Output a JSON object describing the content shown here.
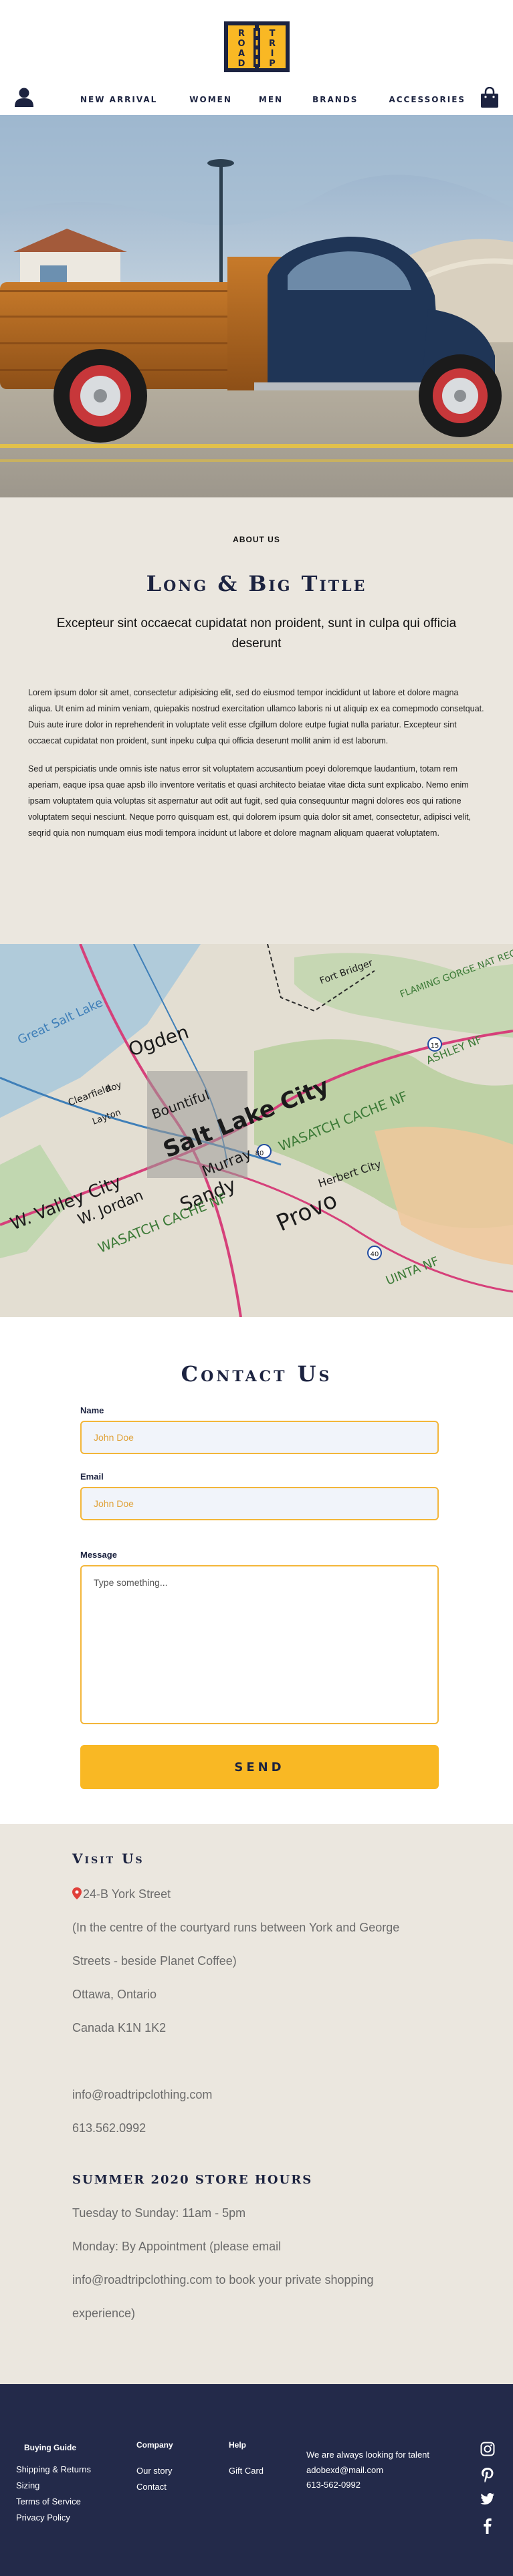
{
  "header": {
    "logo_text": [
      "R",
      "O",
      "A",
      "D",
      "T",
      "R",
      "I",
      "P"
    ],
    "nav": [
      "New arrival",
      "Women",
      "Men",
      "Brands",
      "Accessories"
    ]
  },
  "about": {
    "eyebrow": "ABOUT US",
    "title": "Long & Big Title",
    "subtitle": "Excepteur sint occaecat cupidatat non proident, sunt in culpa qui officia deserunt",
    "paragraphs": [
      "Lorem ipsum dolor sit amet, consectetur adipisicing elit, sed do eiusmod tempor incididunt ut labore et dolore magna aliqua. Ut enim ad minim veniam, quiepakis nostrud exercitation ullamco laboris ni ut aliquip ex ea comepmodo consetquat. Duis aute irure dolor in reprehenderit in voluptate velit esse cfgillum dolore eutpe fugiat nulla pariatur. Excepteur sint occaecat cupidatat non proident, sunt inpeku culpa qui officia deserunt mollit anim id est laborum.",
      "Sed ut perspiciatis unde omnis iste natus error sit voluptatem accusantium poeyi doloremque laudantium, totam rem aperiam, eaque ipsa quae apsb illo inventore veritatis et quasi architecto beiatae vitae dicta sunt explicabo. Nemo enim ipsam voluptatem quia voluptas sit aspernatur aut odit aut fugit, sed quia consequuntur magni dolores eos qui ratione voluptatem sequi nesciunt. Neque porro quisquam est, qui dolorem ipsum quia dolor sit amet, consectetur, adipisci velit, seqrid quia non numquam eius modi tempora incidunt ut labore et dolore magnam aliquam quaerat voluptatem."
    ]
  },
  "map_labels": {
    "ogden": "Ogden",
    "salt_lake_city": "Salt Lake City",
    "bountiful": "Bountiful",
    "clearfield": "Clearfield",
    "layton": "Layton",
    "roy": "Roy",
    "west_valley": "W. Valley City",
    "west_jordan": "W. Jordan",
    "sandy": "Sandy",
    "murray": "Murray",
    "provo": "Provo",
    "herbert_city": "Herbert City",
    "wasatch_cache": "WASATCH CACHE NF",
    "flaming_gorge": "FLAMING GORGE NAT REC AREA",
    "ashley": "ASHLEY NF",
    "uinta": "UINTA NF",
    "fort_bridger": "Fort Bridger",
    "great_salt_lake": "Great Salt Lake",
    "wasatch_cache_2": "WASATCH CACHE NF",
    "rt_80": "80",
    "rt_40": "40",
    "rt_15": "15"
  },
  "contact": {
    "title": "Contact Us",
    "name_label": "Name",
    "name_placeholder": "John Doe",
    "email_label": "Email",
    "email_placeholder": "John Doe",
    "message_label": "Message",
    "message_placeholder": "Type something...",
    "send_label": "SEND"
  },
  "visit": {
    "heading": "Visit Us",
    "address_street": "24-B York Street",
    "address_note_1": "(In the centre of the courtyard runs between York and George",
    "address_note_2": "Streets - beside Planet Coffee)",
    "city": "Ottawa, Ontario",
    "postal": "Canada K1N 1K2",
    "email": "info@roadtripclothing.com",
    "phone": "613.562.0992",
    "hours_heading": "SUMMER 2020 STORE HOURS",
    "hours_1": "Tuesday to Sunday: 11am - 5pm",
    "hours_2": "Monday: By Appointment (please email",
    "hours_3": "info@roadtripclothing.com to book your private shopping",
    "hours_4": "experience)"
  },
  "footer": {
    "buying_title": "Buying Guide",
    "buying_links": [
      "Shipping & Returns",
      "Sizing",
      "Terms of Service",
      "Privacy Policy"
    ],
    "company_title": "Company",
    "company_links": [
      "Our story",
      "Contact"
    ],
    "help_title": "Help",
    "help_links": [
      "Gift Card"
    ],
    "talent_lines": [
      "We are always looking for talent",
      "adobexd@mail.com",
      "613-562-0992"
    ],
    "social_icons": [
      "instagram-icon",
      "pinterest-icon",
      "twitter-icon",
      "facebook-icon"
    ]
  },
  "colors": {
    "navy": "#1c2340",
    "footer_bg": "#232a4a",
    "accent": "#f9b824",
    "cream": "#ebe7df",
    "input_border": "#f3b63a"
  }
}
